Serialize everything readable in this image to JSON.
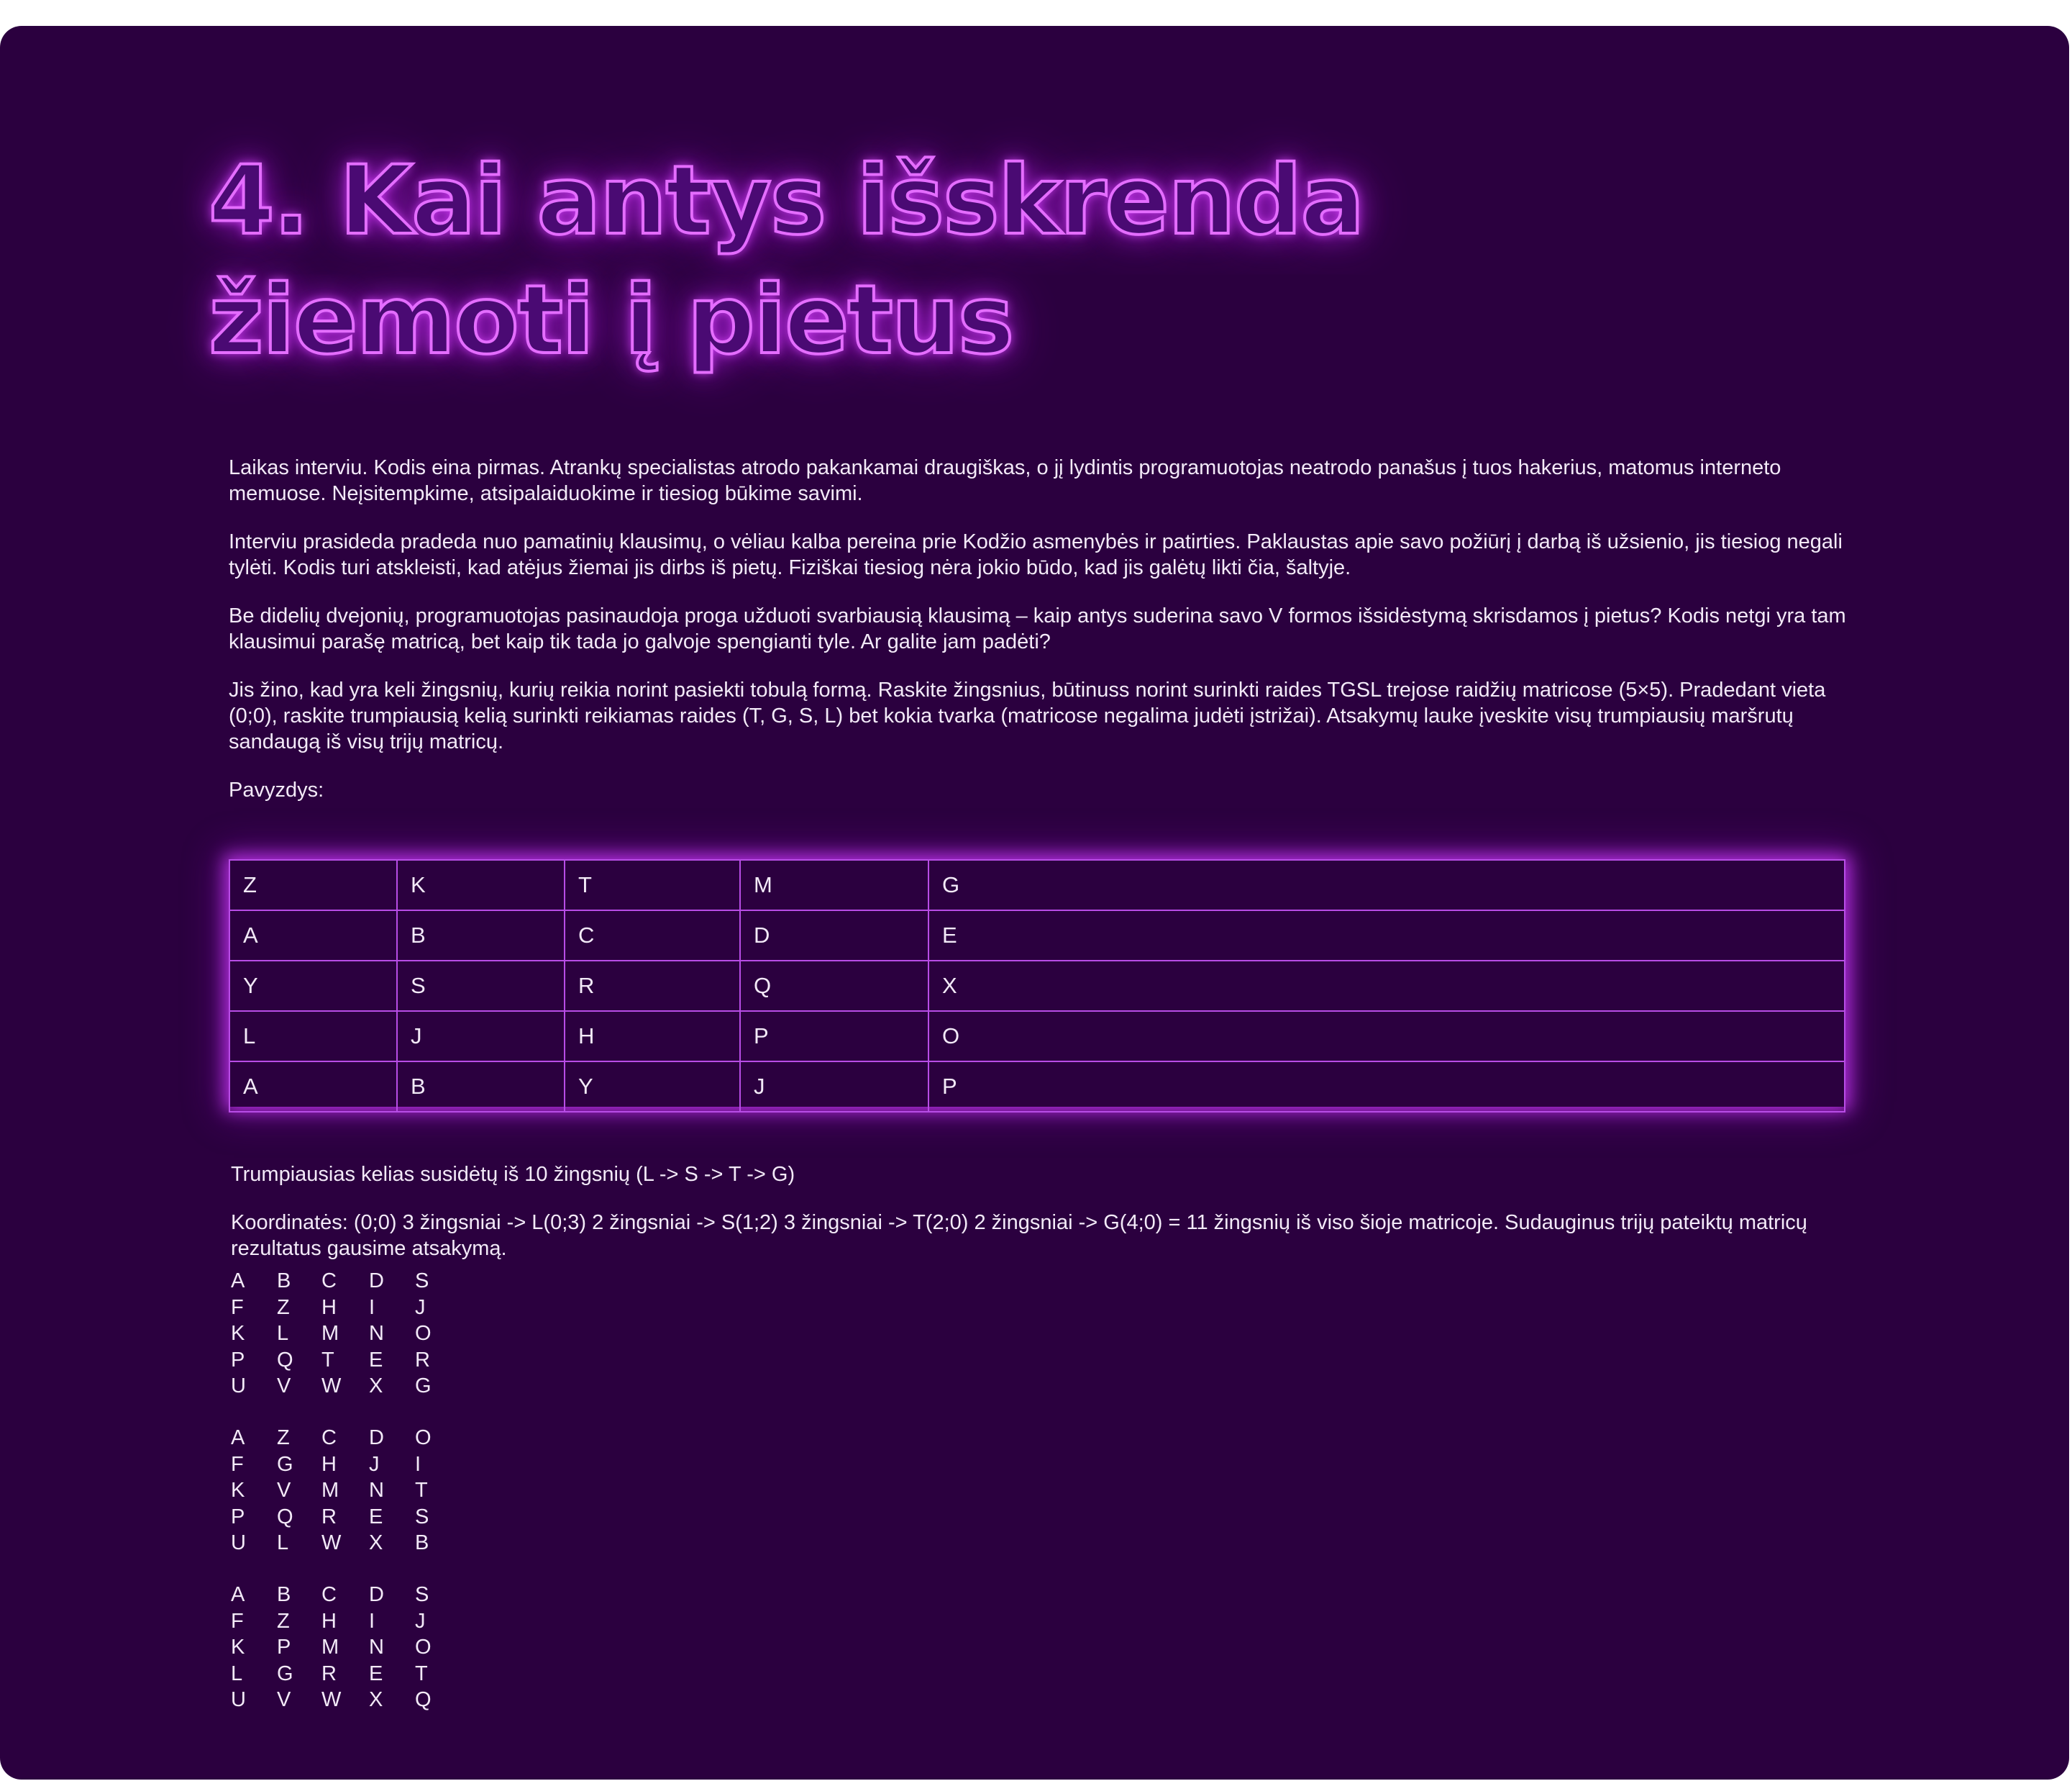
{
  "title": "4. Kai antys išskrenda žiemoti į pietus",
  "paragraphs": [
    "Laikas interviu. Kodis eina pirmas. Atrankų specialistas atrodo pakankamai draugiškas, o jį lydintis programuotojas neatrodo panašus į tuos hakerius, matomus interneto memuose. Neįsitempkime, atsipalaiduokime ir tiesiog būkime savimi.",
    "Interviu prasideda pradeda nuo pamatinių klausimų, o vėliau kalba pereina prie Kodžio asmenybės ir patirties. Paklaustas apie savo požiūrį į darbą iš užsienio, jis tiesiog negali tylėti. Kodis turi atskleisti, kad atėjus žiemai jis dirbs iš pietų. Fiziškai tiesiog nėra jokio būdo, kad jis galėtų likti čia, šaltyje.",
    "Be didelių dvejonių, programuotojas pasinaudoja proga užduoti svarbiausią klausimą – kaip antys suderina savo V formos išsidėstymą skrisdamos į pietus? Kodis netgi yra tam klausimui parašę matricą, bet kaip tik tada jo galvoje spengianti tyle. Ar galite jam padėti?",
    "Jis žino, kad yra keli žingsnių, kurių reikia norint pasiekti tobulą formą. Raskite žingsnius, būtinuss norint surinkti raides TGSL trejose raidžių matricose (5×5). Pradedant vieta (0;0), raskite trumpiausią kelią surinkti reikiamas raides (T, G, S, L) bet kokia tvarka (matricose negalima judėti įstrižai). Atsakymų lauke įveskite visų trumpiausių maršrutų sandaugą iš visų trijų matricų.",
    "Pavyzdys:"
  ],
  "example_grid": [
    [
      "Z",
      "K",
      "T",
      "M",
      "G"
    ],
    [
      "A",
      "B",
      "C",
      "D",
      "E"
    ],
    [
      "Y",
      "S",
      "R",
      "Q",
      "X"
    ],
    [
      "L",
      "J",
      "H",
      "P",
      "O"
    ],
    [
      "A",
      "B",
      "Y",
      "J",
      "P"
    ]
  ],
  "after_paragraphs": [
    "Trumpiausias kelias susidėtų iš 10 žingsnių (L -> S -> T -> G)",
    "Koordinatės: (0;0) 3 žingsniai -> L(0;3) 2 žingsniai -> S(1;2) 3 žingsniai -> T(2;0) 2 žingsniai -> G(4;0) = 11 žingsnių iš viso šioje matricoje. Sudauginus trijų pateiktų matricų rezultatus gausime atsakymą."
  ],
  "matrices": [
    [
      [
        "A",
        "B",
        "C",
        "D",
        "S"
      ],
      [
        "F",
        "Z",
        "H",
        "I",
        "J"
      ],
      [
        "K",
        "L",
        "M",
        "N",
        "O"
      ],
      [
        "P",
        "Q",
        "T",
        "E",
        "R"
      ],
      [
        "U",
        "V",
        "W",
        "X",
        "G"
      ]
    ],
    [
      [
        "A",
        "Z",
        "C",
        "D",
        "O"
      ],
      [
        "F",
        "G",
        "H",
        "J",
        "I"
      ],
      [
        "K",
        "V",
        "M",
        "N",
        "T"
      ],
      [
        "P",
        "Q",
        "R",
        "E",
        "S"
      ],
      [
        "U",
        "L",
        "W",
        "X",
        "B"
      ]
    ],
    [
      [
        "A",
        "B",
        "C",
        "D",
        "S"
      ],
      [
        "F",
        "Z",
        "H",
        "I",
        "J"
      ],
      [
        "K",
        "P",
        "M",
        "N",
        "O"
      ],
      [
        "L",
        "G",
        "R",
        "E",
        "T"
      ],
      [
        "U",
        "V",
        "W",
        "X",
        "Q"
      ]
    ]
  ],
  "colors": {
    "background": "#2b003f",
    "neon_accent": "#e46dff",
    "text": "#f3eaf8",
    "grid_border": "#b84de6"
  }
}
